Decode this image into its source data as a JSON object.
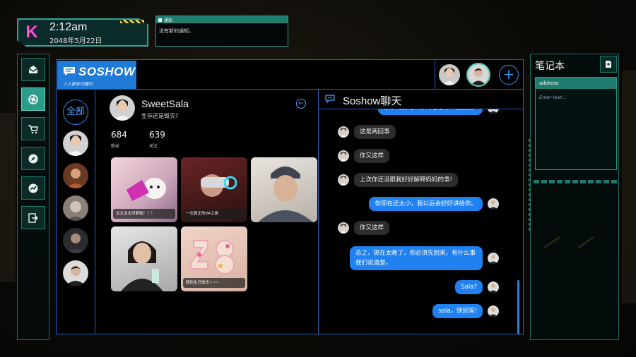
{
  "hud": {
    "logo": "K",
    "time": "2:12am",
    "date": "2048年5月22日"
  },
  "notification": {
    "title": "通知",
    "message": "没有新的通知。"
  },
  "left_nav": {
    "items": [
      "mail-icon",
      "aperture-icon",
      "cart-icon",
      "compass-icon",
      "chart-icon",
      "exit-icon"
    ],
    "active_index": 1
  },
  "app": {
    "brand_name": "SOSHOW",
    "brand_tagline": "人人都有闪耀时",
    "add_label": "+",
    "accent_color": "#1f7ad8",
    "contacts_filter": "全部"
  },
  "profile": {
    "name": "SweetSala",
    "bio": "生存还是毁灭?",
    "followers_count": "684",
    "followers_label": "粉丝",
    "following_count": "639",
    "following_label": "关注",
    "posts": [
      {
        "caption": "太太太太可爱啦！！！"
      },
      {
        "caption": "一次真正的VR之旅"
      },
      {
        "caption": ""
      },
      {
        "caption": ""
      },
      {
        "caption": "我的生日快乐~~~"
      }
    ]
  },
  "chat": {
    "title": "Soshow聊天",
    "messages": [
      {
        "from": "me",
        "text": "孩子的前途和你的爸爸哪个更重要?"
      },
      {
        "from": "them",
        "text": "这是两回事"
      },
      {
        "from": "them",
        "text": "你又这样"
      },
      {
        "from": "them",
        "text": "上次你还没跟我好好解释妈妈的事!"
      },
      {
        "from": "me",
        "text": "你现在还太小，我以后会好好讲给你。"
      },
      {
        "from": "them",
        "text": "你又这样"
      },
      {
        "from": "me",
        "text": "总之，现在太晚了，你必须先回来，有什么事我们说清楚。"
      },
      {
        "from": "me",
        "text": "Sala?"
      },
      {
        "from": "me",
        "text": "sala，快回答!"
      }
    ]
  },
  "notebook": {
    "title": "笔记本",
    "note_title": "address",
    "note_placeholder": "Enter text..."
  }
}
